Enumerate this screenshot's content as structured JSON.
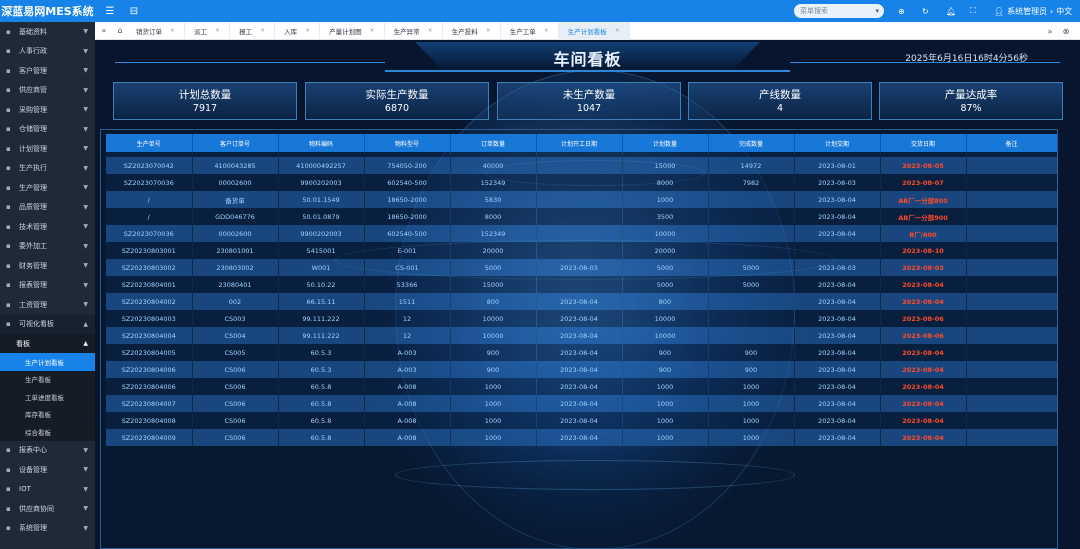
{
  "app": {
    "title": "深蓝易网MES系统"
  },
  "topbar": {
    "search_placeholder": "菜单搜索",
    "user_label": "系统管理员",
    "lang_label": "中文"
  },
  "sidebar": {
    "items_top": [
      {
        "label": "基础资料",
        "icon": "grid-icon"
      },
      {
        "label": "人事行政",
        "icon": "user-icon"
      },
      {
        "label": "客户管理",
        "icon": "customer-icon"
      },
      {
        "label": "供应商管",
        "icon": "supplier-icon"
      },
      {
        "label": "采购管理",
        "icon": "cart-icon"
      },
      {
        "label": "仓储管理",
        "icon": "warehouse-icon"
      },
      {
        "label": "计划管理",
        "icon": "plan-icon"
      },
      {
        "label": "生产执行",
        "icon": "production-icon"
      },
      {
        "label": "生产管理",
        "icon": "factory-icon"
      },
      {
        "label": "品质管理",
        "icon": "quality-icon"
      },
      {
        "label": "技术管理",
        "icon": "tech-icon"
      },
      {
        "label": "委外加工",
        "icon": "outsource-icon"
      },
      {
        "label": "财务管理",
        "icon": "finance-icon"
      },
      {
        "label": "报表管理",
        "icon": "report-icon"
      },
      {
        "label": "工资管理",
        "icon": "wage-icon"
      },
      {
        "label": "可视化看板",
        "icon": "dashboard-icon"
      }
    ],
    "sub_head": "看板",
    "sub_items": [
      {
        "label": "生产计划看板",
        "active": true
      },
      {
        "label": "生产看板",
        "active": false
      },
      {
        "label": "工单进度看板",
        "active": false
      },
      {
        "label": "库存看板",
        "active": false
      },
      {
        "label": "综合看板",
        "active": false
      }
    ],
    "items_bottom": [
      {
        "label": "报表中心",
        "icon": "chart-icon"
      },
      {
        "label": "设备管理",
        "icon": "device-icon"
      },
      {
        "label": "IOT",
        "icon": "iot-icon"
      },
      {
        "label": "供应商协同",
        "icon": "collab-icon"
      },
      {
        "label": "系统管理",
        "icon": "settings-icon"
      }
    ]
  },
  "tabs": [
    {
      "label": "销货订单",
      "active": false
    },
    {
      "label": "派工",
      "active": false
    },
    {
      "label": "报工",
      "active": false
    },
    {
      "label": "入库",
      "active": false
    },
    {
      "label": "产量计划图",
      "active": false
    },
    {
      "label": "生产异常",
      "active": false
    },
    {
      "label": "生产投料",
      "active": false
    },
    {
      "label": "生产工单",
      "active": false
    },
    {
      "label": "生产计划看板",
      "active": true
    }
  ],
  "board": {
    "title": "车间看板",
    "datetime": "2025年6月16日16时4分56秒",
    "kpis": [
      {
        "label": "计划总数量",
        "value": "7917"
      },
      {
        "label": "实际生产数量",
        "value": "6870"
      },
      {
        "label": "未生产数量",
        "value": "1047"
      },
      {
        "label": "产线数量",
        "value": "4"
      },
      {
        "label": "产量达成率",
        "value": "87%"
      }
    ]
  },
  "table": {
    "headers": [
      "生产单号",
      "客户订单号",
      "物料编码",
      "物料型号",
      "订单数量",
      "计划开工日期",
      "计划数量",
      "完成数量",
      "计划交期",
      "交货日期",
      "备注"
    ],
    "rows": [
      [
        "SZ2023070042",
        "4100043285",
        "410000492257",
        "754050-200",
        "40000",
        "",
        "15000",
        "14972",
        "2023-08-01",
        "2023-08-05",
        ""
      ],
      [
        "SZ2023070036",
        "00002600",
        "9900202003",
        "602540-500",
        "152349",
        "",
        "8000",
        "7982",
        "2023-08-03",
        "2023-08-07",
        ""
      ],
      [
        "/",
        "备货单",
        "50.01.1549",
        "18650-2000",
        "5830",
        "",
        "1000",
        "",
        "2023-08-04",
        "AB厂一分部800",
        ""
      ],
      [
        "/",
        "GDD046776",
        "50.01.0879",
        "18650-2000",
        "8000",
        "",
        "3500",
        "",
        "2023-08-04",
        "AB厂一分部900",
        ""
      ],
      [
        "SZ2023070036",
        "00002600",
        "9900202003",
        "602540-500",
        "152349",
        "",
        "10000",
        "",
        "2023-08-04",
        "B厂/600",
        ""
      ],
      [
        "SZ20230803001",
        "230801001",
        "5415001",
        "E-001",
        "20000",
        "",
        "20000",
        "",
        "",
        "2023-08-10",
        ""
      ],
      [
        "SZ20230803002",
        "230803002",
        "W001",
        "CS-001",
        "5000",
        "2023-08-03",
        "5000",
        "5000",
        "2023-08-03",
        "2023-08-03",
        ""
      ],
      [
        "SZ20230804001",
        "23080401",
        "50.10.22",
        "53366",
        "15000",
        "",
        "5000",
        "5000",
        "2023-08-04",
        "2023-08-04",
        ""
      ],
      [
        "SZ20230804002",
        "002",
        "66.15.11",
        "1511",
        "800",
        "2023-08-04",
        "800",
        "",
        "2023-08-04",
        "2023-08-04",
        ""
      ],
      [
        "SZ20230804003",
        "CS003",
        "99.111.222",
        "12",
        "10000",
        "2023-08-04",
        "10000",
        "",
        "2023-08-04",
        "2023-08-06",
        ""
      ],
      [
        "SZ20230804004",
        "CS004",
        "99.111.222",
        "12",
        "10000",
        "2023-08-04",
        "10000",
        "",
        "2023-08-04",
        "2023-08-06",
        ""
      ],
      [
        "SZ20230804005",
        "CS005",
        "60.5.3",
        "A-003",
        "900",
        "2023-08-04",
        "900",
        "900",
        "2023-08-04",
        "2023-08-04",
        ""
      ],
      [
        "SZ20230804006",
        "CS006",
        "60.5.3",
        "A-003",
        "900",
        "2023-08-04",
        "900",
        "900",
        "2023-08-04",
        "2023-08-04",
        ""
      ],
      [
        "SZ20230804006",
        "CS006",
        "60.5.8",
        "A-008",
        "1000",
        "2023-08-04",
        "1000",
        "1000",
        "2023-08-04",
        "2023-08-04",
        ""
      ],
      [
        "SZ20230804007",
        "CS006",
        "60.5.8",
        "A-008",
        "1000",
        "2023-08-04",
        "1000",
        "1000",
        "2023-08-04",
        "2023-08-04",
        ""
      ],
      [
        "SZ20230804008",
        "CS006",
        "60.5.8",
        "A-008",
        "1000",
        "2023-08-04",
        "1000",
        "1000",
        "2023-08-04",
        "2023-08-04",
        ""
      ],
      [
        "SZ20230804009",
        "CS006",
        "60.5.8",
        "A-008",
        "1000",
        "2023-08-04",
        "1000",
        "1000",
        "2023-08-04",
        "2023-08-04",
        ""
      ]
    ]
  },
  "colors": {
    "accent": "#1783e8",
    "alert": "#ff4b2b",
    "cell_text": "#9fd3ff"
  }
}
